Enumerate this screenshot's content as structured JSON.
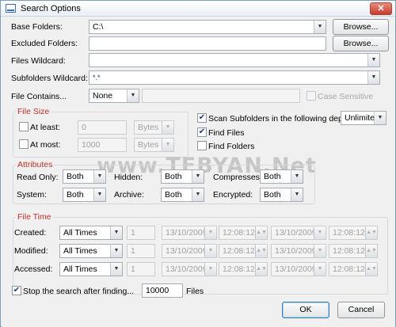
{
  "window": {
    "title": "Search Options",
    "close_glyph": "✕",
    "icon": "window-icon"
  },
  "base": {
    "label": "Base Folders:",
    "value": "C:\\",
    "browse": "Browse..."
  },
  "excluded": {
    "label": "Excluded Folders:",
    "value": "",
    "browse": "Browse..."
  },
  "wildcard": {
    "label": "Files Wildcard:",
    "value": ""
  },
  "subwildcard": {
    "label": "Subfolders Wildcard:",
    "value": "*.*"
  },
  "contains": {
    "label": "File Contains...",
    "mode": "None",
    "value": "",
    "case_label": "Case Sensitive"
  },
  "filesize": {
    "title": "File Size",
    "atleast": {
      "label": "At least:",
      "value": "0",
      "unit": "Bytes"
    },
    "atmost": {
      "label": "At most:",
      "value": "1000",
      "unit": "Bytes"
    }
  },
  "scan": {
    "label": "Scan Subfolders in the following depth:",
    "depth": "Unlimited",
    "checked": "✔"
  },
  "findfiles": {
    "label": "Find Files",
    "checked": "✔"
  },
  "findfolders": {
    "label": "Find Folders"
  },
  "attributes": {
    "title": "Attributes",
    "readonly": {
      "label": "Read Only:",
      "value": "Both"
    },
    "hidden": {
      "label": "Hidden:",
      "value": "Both"
    },
    "compresses": {
      "label": "Compresses:",
      "value": "Both"
    },
    "system": {
      "label": "System:",
      "value": "Both"
    },
    "archive": {
      "label": "Archive:",
      "value": "Both"
    },
    "encrypted": {
      "label": "Encrypted:",
      "value": "Both"
    }
  },
  "filetime": {
    "title": "File Time",
    "rows": [
      {
        "label": "Created:",
        "mode": "All Times",
        "num": "1",
        "date1": "13/10/2009",
        "time1": "12:08:12",
        "date2": "13/10/2009",
        "time2": "12:08:12"
      },
      {
        "label": "Modified:",
        "mode": "All Times",
        "num": "1",
        "date1": "13/10/2009",
        "time1": "12:08:12",
        "date2": "13/10/2009",
        "time2": "12:08:12"
      },
      {
        "label": "Accessed:",
        "mode": "All Times",
        "num": "1",
        "date1": "13/10/2009",
        "time1": "12:08:12",
        "date2": "13/10/2009",
        "time2": "12:08:12"
      }
    ]
  },
  "stop": {
    "label": "Stop the search after finding...",
    "value": "10000",
    "suffix": "Files",
    "checked": "✔"
  },
  "ok": "OK",
  "cancel": "Cancel",
  "watermark": "www.TEBYAN.Net",
  "icons": {
    "dropdown": "▼",
    "spin": "▲▼"
  }
}
